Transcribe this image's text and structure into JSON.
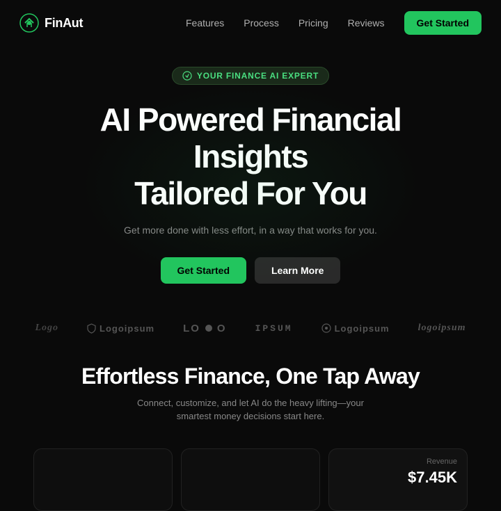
{
  "brand": {
    "name": "FinAut"
  },
  "nav": {
    "links": [
      {
        "label": "Features",
        "id": "features"
      },
      {
        "label": "Process",
        "id": "process"
      },
      {
        "label": "Pricing",
        "id": "pricing"
      },
      {
        "label": "Reviews",
        "id": "reviews"
      }
    ],
    "cta": "Get Started"
  },
  "hero": {
    "badge": "YOUR FINANCE AI EXPERT",
    "title_line1": "AI Powered Financial Insights",
    "title_line2": "Tailored For You",
    "subtitle": "Get more done with less effort, in a way that works for you.",
    "btn_primary": "Get Started",
    "btn_secondary": "Learn More"
  },
  "logos": [
    {
      "label": "Logo",
      "style": "serif"
    },
    {
      "label": "Logoipsum",
      "style": "shield"
    },
    {
      "label": "LOGO",
      "style": "dot"
    },
    {
      "label": "IPSUM",
      "style": "mono"
    },
    {
      "label": "Logoipsum",
      "style": "circle"
    },
    {
      "label": "logoipsum",
      "style": "italic-serif"
    }
  ],
  "section": {
    "title": "Effortless Finance, One Tap Away",
    "desc": "Connect, customize, and let AI do the heavy lifting—your smartest money decisions start here."
  },
  "card_revenue": {
    "label": "Revenue",
    "value": "$7.45K"
  }
}
